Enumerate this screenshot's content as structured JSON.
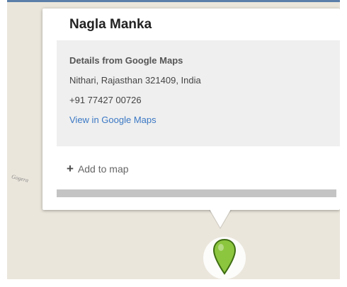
{
  "map": {
    "label": "Gogera"
  },
  "popup": {
    "title": "Nagla Manka",
    "details_heading": "Details from Google Maps",
    "address": "Nithari, Rajasthan 321409, India",
    "phone": "+91 77427 00726",
    "view_link": "View in Google Maps",
    "add_to_map": "Add to map"
  },
  "marker": {
    "color": "#8cc63f",
    "icon": "map-pin-icon"
  },
  "colors": {
    "link": "#3b78c4",
    "map_bg": "#ebe6dc",
    "details_bg": "#efefef"
  }
}
